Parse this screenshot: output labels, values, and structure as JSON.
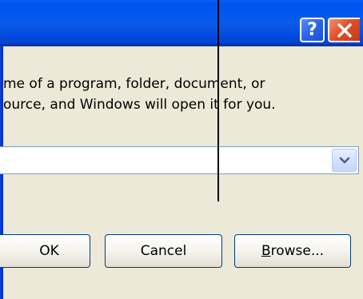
{
  "titlebar": {
    "help_label": "?",
    "help_icon": "question-mark-icon",
    "close_icon": "close-x-icon",
    "colors": {
      "bar": "#0058f0",
      "close": "#e0502a"
    }
  },
  "instruction": {
    "line1": "me of a program, folder, document, or",
    "line2": "ource, and Windows will open it for you."
  },
  "open_field": {
    "value": "",
    "dropdown_icon": "chevron-down-icon"
  },
  "buttons": {
    "ok": "OK",
    "cancel": "Cancel",
    "browse_mnemonic": "B",
    "browse_rest": "rowse..."
  }
}
